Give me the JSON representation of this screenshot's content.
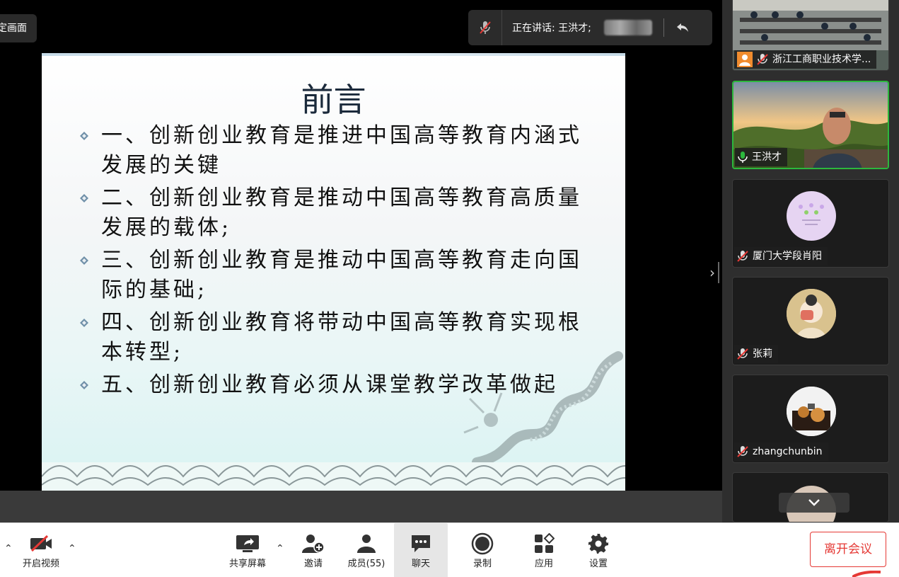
{
  "stage": {
    "lock_view_label": "定画面",
    "speaker_prefix": "正在讲话: 王洪才;"
  },
  "slide": {
    "title": "前言",
    "bullets": [
      {
        "line1": "一、创新创业教育是推进中国高等教育内涵式",
        "line2": "发展的关键"
      },
      {
        "line1": "二、创新创业教育是推动中国高等教育高质量",
        "line2": "发展的载体;"
      },
      {
        "line1": "三、创新创业教育是推动中国高等教育走向国",
        "line2": "际的基础;"
      },
      {
        "line1": "四、创新创业教育将带动中国高等教育实现根",
        "line2": "本转型;"
      },
      {
        "line1": "五、创新创业教育必须从课堂教学改革做起",
        "line2": ""
      }
    ]
  },
  "participants": [
    {
      "name": "浙江工商职业技术学...",
      "muted": true,
      "kind": "classroom-video"
    },
    {
      "name": "王洪才",
      "muted": false,
      "kind": "speaker-video"
    },
    {
      "name": "厦门大学段肖阳",
      "muted": true,
      "kind": "avatar"
    },
    {
      "name": "张莉",
      "muted": true,
      "kind": "avatar"
    },
    {
      "name": "zhangchunbin",
      "muted": true,
      "kind": "avatar"
    }
  ],
  "toolbar": {
    "video_label": "开启视频",
    "share_label": "共享屏幕",
    "invite_label": "邀请",
    "members_label": "成员(55)",
    "chat_label": "聊天",
    "record_label": "录制",
    "apps_label": "应用",
    "settings_label": "设置",
    "leave_label": "离开会议"
  },
  "colors": {
    "active_speaker_border": "#2cb83d",
    "leave_button": "#e53935",
    "muted_icon": "#e53935"
  }
}
